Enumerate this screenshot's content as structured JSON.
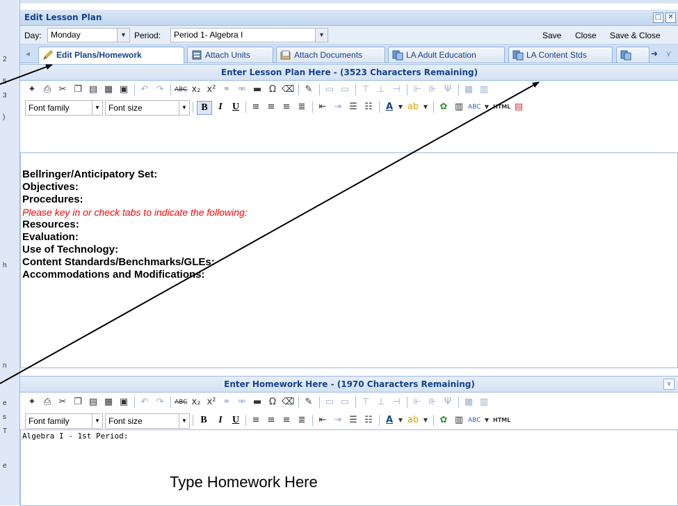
{
  "window": {
    "title": "Edit Lesson Plan"
  },
  "toolbar": {
    "day_label": "Day:",
    "day_value": "Monday",
    "period_label": "Period:",
    "period_value": "Period 1- Algebra I",
    "save": "Save",
    "close": "Close",
    "save_close": "Save & Close"
  },
  "tabs": [
    {
      "label": "Edit Plans/Homework",
      "icon": "pencil-icon"
    },
    {
      "label": "Attach Units",
      "icon": "units-icon"
    },
    {
      "label": "Attach Documents",
      "icon": "documents-icon"
    },
    {
      "label": "LA Adult Education",
      "icon": "standards-icon"
    },
    {
      "label": "LA Content Stds",
      "icon": "standards-icon"
    }
  ],
  "lesson_section": {
    "header": "Enter Lesson Plan Here - (3523 Characters Remaining)",
    "font_family": "Font family",
    "font_size": "Font size",
    "lines": [
      "Bellringer/Anticipatory Set:",
      "Objectives:",
      "Procedures:",
      "Please key in or check tabs to indicate the following:",
      "Resources:",
      "Evaluation:",
      "Use of Technology:",
      "Content Standards/Benchmarks/GLEs:",
      "Accommodations and Modifications:"
    ]
  },
  "homework_section": {
    "header": "Enter Homework Here - (1970 Characters Remaining)",
    "font_family": "Font family",
    "font_size": "Font size",
    "content": "Algebra I - 1st Period:",
    "annotation": "Type Homework Here"
  },
  "left_bg": [
    "2",
    "5",
    "3",
    ")",
    "n",
    "e",
    "s",
    "T",
    "h",
    "e"
  ],
  "colors": {
    "header_text": "#15428b",
    "accent_red": "#ff0000",
    "border": "#99bbe8"
  }
}
